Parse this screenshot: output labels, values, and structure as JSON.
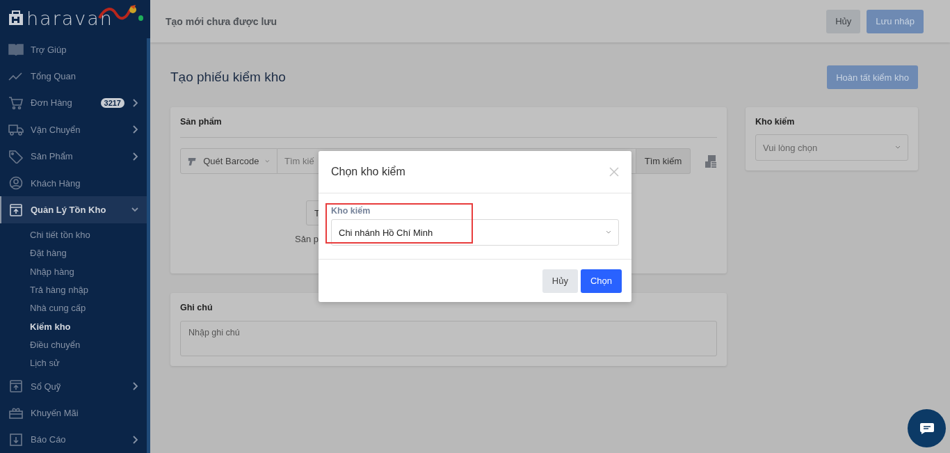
{
  "sidebar": {
    "logo": "haravan",
    "online": true,
    "items": [
      {
        "label": "Trợ Giúp",
        "selected": false,
        "expandable": false
      },
      {
        "label": "Tổng Quan",
        "selected": false,
        "expandable": false
      },
      {
        "label": "Đơn Hàng",
        "badge": "3217",
        "selected": false,
        "expandable": true,
        "expanded": false
      },
      {
        "label": "Vận Chuyển",
        "selected": false,
        "expandable": true,
        "expanded": false
      },
      {
        "label": "Sản Phẩm",
        "selected": false,
        "expandable": true,
        "expanded": false
      },
      {
        "label": "Khách Hàng",
        "selected": false,
        "expandable": false
      },
      {
        "label": "Quản Lý Tồn Kho",
        "selected": true,
        "expandable": true,
        "expanded": true,
        "children": [
          {
            "label": "Chi tiết tồn kho",
            "selected": false
          },
          {
            "label": "Đặt hàng",
            "selected": false
          },
          {
            "label": "Nhập hàng",
            "selected": false
          },
          {
            "label": "Trả hàng nhập",
            "selected": false
          },
          {
            "label": "Nhà cung cấp",
            "selected": false
          },
          {
            "label": "Kiểm kho",
            "selected": true
          },
          {
            "label": "Điều chuyển",
            "selected": false
          },
          {
            "label": "Lịch sử",
            "selected": false
          }
        ]
      },
      {
        "label": "Sổ Quỹ",
        "selected": false,
        "expandable": true,
        "expanded": false
      },
      {
        "label": "Khuyến Mãi",
        "selected": false,
        "expandable": false
      },
      {
        "label": "Báo Cáo",
        "selected": false,
        "expandable": true,
        "expanded": false
      }
    ]
  },
  "top_bar": {
    "title": "Tạo mới chưa được lưu",
    "buttons": [
      {
        "label": "Hủy",
        "kind": "secondary"
      },
      {
        "label": "Lưu nháp",
        "kind": "primary"
      }
    ]
  },
  "page": {
    "title": "Tạo phiếu kiểm kho",
    "complete_button": "Hoàn tất kiểm kho"
  },
  "products_card": {
    "title": "Sản phẩm",
    "scan_mode": "Quét Barcode",
    "search_placeholder": "Tìm kiế",
    "search_button": "Tìm kiếm",
    "partial_button": "T",
    "partial_text": "Sản p"
  },
  "warehouse_card": {
    "title": "Kho kiểm",
    "placeholder": "Vui lòng chọn"
  },
  "note_card": {
    "title": "Ghi chú",
    "placeholder": "Nhập ghi chú"
  },
  "dialog": {
    "title": "Chọn kho kiểm",
    "field_label": "Kho kiểm",
    "value": "Chi nhánh Hồ Chí Minh",
    "highlighted": true,
    "buttons": [
      {
        "label": "Hủy",
        "kind": "secondary"
      },
      {
        "label": "Chọn",
        "kind": "primary"
      }
    ]
  }
}
